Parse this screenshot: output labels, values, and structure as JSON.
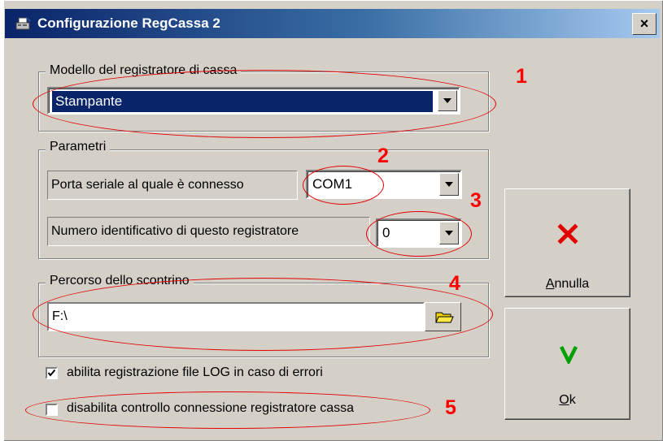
{
  "window": {
    "title": "Configurazione RegCassa 2",
    "close_label": "×"
  },
  "modello": {
    "group_label": "Modello del registratore di cassa",
    "selected": "Stampante"
  },
  "parametri": {
    "group_label": "Parametri",
    "porta_label": "Porta seriale al quale è connesso",
    "porta_value": "COM1",
    "numero_label": "Numero identificativo di questo registratore",
    "numero_value": "0"
  },
  "percorso": {
    "group_label": "Percorso dello scontrino",
    "value": "F:\\"
  },
  "checkboxes": [
    {
      "label": "abilita registrazione file LOG in caso di errori",
      "checked": true
    },
    {
      "label": "disabilita controllo connessione registratore cassa",
      "checked": false
    }
  ],
  "buttons": {
    "annulla": {
      "label": "Annulla",
      "icon": "x-icon",
      "color": "#e00000"
    },
    "ok": {
      "label": "Ok",
      "icon": "v-icon",
      "color": "#00a000"
    }
  },
  "annotations": [
    "1",
    "2",
    "3",
    "4",
    "5"
  ]
}
